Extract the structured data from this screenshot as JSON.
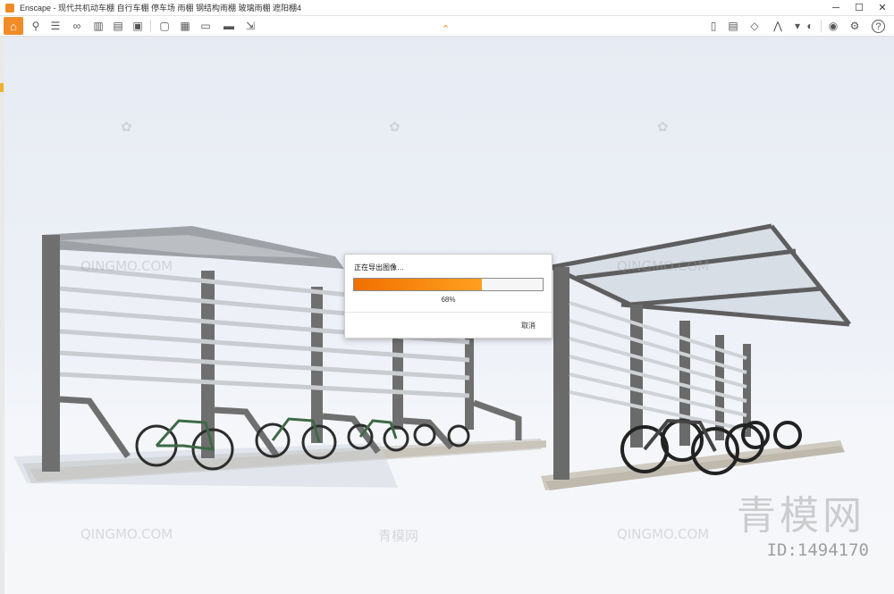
{
  "window": {
    "title": "Enscape - 现代共机动车棚 自行车棚 停车场 雨棚 钢结构雨棚 玻璃雨棚 遮阳棚4",
    "controls": {
      "minimize": "─",
      "maximize": "☐",
      "close": "✕"
    }
  },
  "toolbar": {
    "left_icons": [
      "home-icon",
      "link-icon",
      "video-path-icon",
      "binoculars-icon",
      "buildings-icon",
      "sun-icon",
      "clapper-icon",
      "screenshot-icon",
      "export-icon",
      "panorama-icon",
      "vr-headset-icon",
      "render-export-icon"
    ],
    "right_icons": [
      "asset-library-icon",
      "video-editor-icon",
      "view-mode-icon",
      "sketch-mode-icon",
      "mode-dropdown-icon",
      "visual-settings-icon",
      "feedback-icon",
      "settings-icon",
      "help-icon"
    ],
    "help_label": "?"
  },
  "dialog": {
    "title": "正在导出图像…",
    "progress_percent": 68,
    "progress_label": "68%",
    "cancel_label": "取消"
  },
  "watermark": {
    "brand_cn": "青模网",
    "brand_en": "QINGMO.COM",
    "id_label": "ID:1494170"
  },
  "colors": {
    "accent": "#f28c28",
    "progress_start": "#f07000",
    "progress_end": "#ffa020"
  }
}
